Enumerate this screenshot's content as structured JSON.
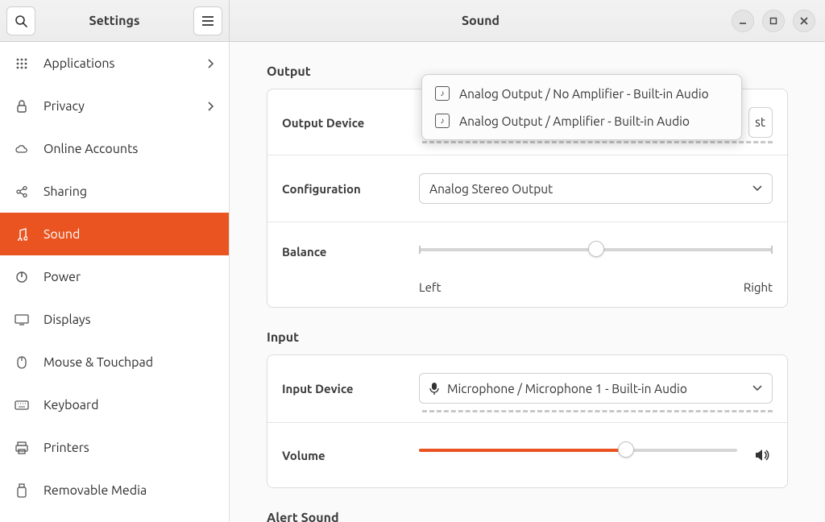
{
  "titlebar": {
    "settings_label": "Settings",
    "page_title": "Sound"
  },
  "sidebar": {
    "items": [
      {
        "label": "Applications",
        "icon": "grid-icon",
        "chevron": true
      },
      {
        "label": "Privacy",
        "icon": "lock-icon",
        "chevron": true
      },
      {
        "label": "Online Accounts",
        "icon": "cloud-icon",
        "chevron": false
      },
      {
        "label": "Sharing",
        "icon": "share-icon",
        "chevron": false
      },
      {
        "label": "Sound",
        "icon": "music-icon",
        "chevron": false,
        "active": true
      },
      {
        "label": "Power",
        "icon": "power-icon",
        "chevron": false
      },
      {
        "label": "Displays",
        "icon": "display-icon",
        "chevron": false
      },
      {
        "label": "Mouse & Touchpad",
        "icon": "mouse-icon",
        "chevron": false
      },
      {
        "label": "Keyboard",
        "icon": "keyboard-icon",
        "chevron": false
      },
      {
        "label": "Printers",
        "icon": "printer-icon",
        "chevron": false
      },
      {
        "label": "Removable Media",
        "icon": "usb-icon",
        "chevron": false
      }
    ]
  },
  "output": {
    "section_title": "Output",
    "device_label": "Output Device",
    "device_value": "Analog Output / No Amplifier - Built-in Audio",
    "test_label": "Test",
    "test_visible_fragment": "st",
    "configuration_label": "Configuration",
    "configuration_value": "Analog Stereo Output",
    "balance_label": "Balance",
    "balance_left": "Left",
    "balance_right": "Right",
    "balance_position_pct": 50,
    "dropdown_options": [
      "Analog Output / No Amplifier - Built-in Audio",
      "Analog Output / Amplifier - Built-in Audio"
    ]
  },
  "input": {
    "section_title": "Input",
    "device_label": "Input Device",
    "device_value": "Microphone / Microphone 1 - Built-in Audio",
    "volume_label": "Volume",
    "volume_pct": 65
  },
  "alert": {
    "section_title": "Alert Sound"
  },
  "colors": {
    "accent": "#e95420"
  }
}
